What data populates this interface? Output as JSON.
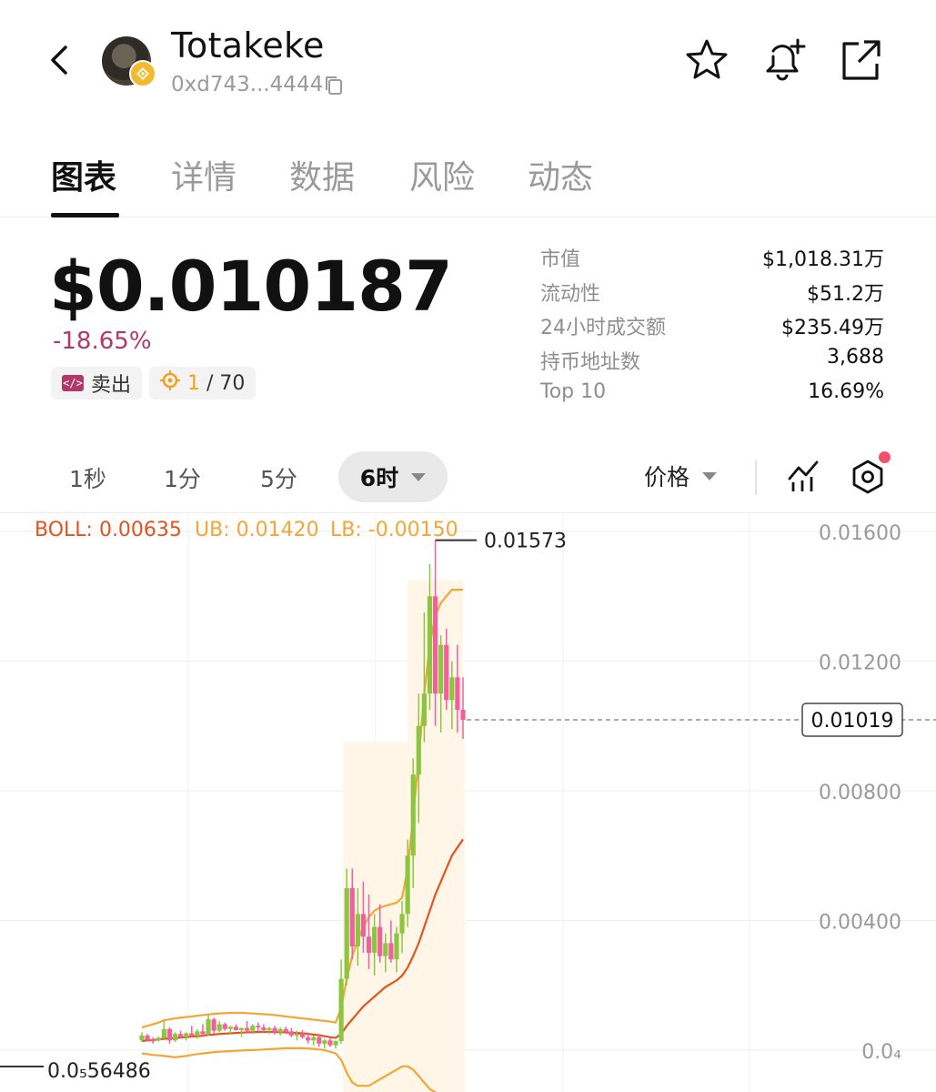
{
  "header": {
    "back_icon": "chevron-left-icon",
    "token_name": "Totakeke",
    "address": "0xd743...4444",
    "icons": [
      "star-icon",
      "bell-plus-icon",
      "external-link-icon"
    ]
  },
  "tabs": [
    {
      "label": "图表",
      "active": true
    },
    {
      "label": "详情",
      "active": false
    },
    {
      "label": "数据",
      "active": false
    },
    {
      "label": "风险",
      "active": false
    },
    {
      "label": "动态",
      "active": false
    }
  ],
  "price": {
    "value": "$0.010187",
    "change": "-18.65%",
    "change_color": "#b0386a",
    "sell_label": "卖出",
    "rank_highlight": "1",
    "rank_rest": " / 70"
  },
  "stats": [
    {
      "label": "市值",
      "value": "$1,018.31万"
    },
    {
      "label": "流动性",
      "value": "$51.2万"
    },
    {
      "label": "24小时成交额",
      "value": "$235.49万"
    },
    {
      "label": "持币地址数",
      "value": "3,688"
    },
    {
      "label": "Top 10",
      "value": "16.69%"
    }
  ],
  "timeframes": {
    "options": [
      "1秒",
      "1分",
      "5分"
    ],
    "selected": "6时",
    "price_mode": "价格"
  },
  "indicator": {
    "boll": "BOLL: 0.00635",
    "ub": "UB: 0.01420",
    "lb": "LB: -0.00150",
    "boll_color": "#e0541e",
    "band_color": "#f3a536"
  },
  "chart_data": {
    "type": "candlestick",
    "y_ticks": [
      "0.01600",
      "0.01200",
      "0.00800",
      "0.00400",
      "0.0₄"
    ],
    "y_tick_values": [
      0.016,
      0.012,
      0.008,
      0.004,
      0.0
    ],
    "current_price_label": "0.01019",
    "current_price": 0.01019,
    "high_label": "0.01573",
    "high": 0.01573,
    "low_label": "0.0₅56486",
    "up_color": "#8cc63f",
    "down_color": "#f0609e",
    "candles": [
      [
        0.0003,
        0.00055,
        0.00025,
        0.00045
      ],
      [
        0.00045,
        0.0005,
        0.00028,
        0.00032
      ],
      [
        0.00032,
        0.0004,
        0.0002,
        0.0003
      ],
      [
        0.0003,
        0.00042,
        0.00026,
        0.00038
      ],
      [
        0.00038,
        0.0009,
        0.0003,
        0.00065
      ],
      [
        0.00065,
        0.0007,
        0.0002,
        0.0003
      ],
      [
        0.0003,
        0.00055,
        0.00025,
        0.0005
      ],
      [
        0.0005,
        0.0006,
        0.00035,
        0.0004
      ],
      [
        0.0004,
        0.00055,
        0.0003,
        0.00052
      ],
      [
        0.00052,
        0.00075,
        0.0004,
        0.00045
      ],
      [
        0.00045,
        0.00065,
        0.00035,
        0.00058
      ],
      [
        0.00058,
        0.0008,
        0.0004,
        0.0005
      ],
      [
        0.0005,
        0.0011,
        0.00045,
        0.00095
      ],
      [
        0.00095,
        0.001,
        0.0005,
        0.0006
      ],
      [
        0.0006,
        0.0009,
        0.00055,
        0.0008
      ],
      [
        0.0008,
        0.00085,
        0.0006,
        0.00065
      ],
      [
        0.00065,
        0.00075,
        0.0005,
        0.00072
      ],
      [
        0.00072,
        0.0008,
        0.0006,
        0.00062
      ],
      [
        0.00062,
        0.0007,
        0.0004,
        0.00068
      ],
      [
        0.00068,
        0.0009,
        0.00055,
        0.0006
      ],
      [
        0.0006,
        0.0008,
        0.0005,
        0.00075
      ],
      [
        0.00075,
        0.00085,
        0.0006,
        0.0007
      ],
      [
        0.0007,
        0.0008,
        0.00055,
        0.00062
      ],
      [
        0.00062,
        0.00072,
        0.0005,
        0.00068
      ],
      [
        0.00068,
        0.00075,
        0.00048,
        0.00055
      ],
      [
        0.00055,
        0.0007,
        0.00045,
        0.00065
      ],
      [
        0.00065,
        0.00072,
        0.0005,
        0.00058
      ],
      [
        0.00058,
        0.00068,
        0.0004,
        0.00045
      ],
      [
        0.00045,
        0.0006,
        0.0003,
        0.0005
      ],
      [
        0.0005,
        0.00062,
        0.00035,
        0.0004
      ],
      [
        0.0004,
        0.00055,
        0.0002,
        0.0003
      ],
      [
        0.0003,
        0.00045,
        0.00015,
        0.0004
      ],
      [
        0.0004,
        0.0005,
        0.0001,
        0.0002
      ],
      [
        0.0002,
        0.00035,
        5e-05,
        0.0003
      ],
      [
        0.0003,
        0.0004,
        0.0001,
        0.00015
      ],
      [
        0.00015,
        0.0003,
        5e-05,
        0.00028
      ],
      [
        0.00028,
        0.0028,
        0.0002,
        0.0022
      ],
      [
        0.0022,
        0.0056,
        0.002,
        0.005
      ],
      [
        0.005,
        0.0056,
        0.0028,
        0.0032
      ],
      [
        0.0032,
        0.005,
        0.0026,
        0.0042
      ],
      [
        0.0042,
        0.0052,
        0.003,
        0.0035
      ],
      [
        0.0035,
        0.0048,
        0.0025,
        0.003
      ],
      [
        0.003,
        0.0042,
        0.0023,
        0.0038
      ],
      [
        0.0038,
        0.0045,
        0.0027,
        0.0029
      ],
      [
        0.0029,
        0.0036,
        0.0024,
        0.0033
      ],
      [
        0.0033,
        0.004,
        0.0027,
        0.0028
      ],
      [
        0.0028,
        0.0038,
        0.0024,
        0.0036
      ],
      [
        0.0036,
        0.0046,
        0.003,
        0.0042
      ],
      [
        0.0042,
        0.0065,
        0.0038,
        0.006
      ],
      [
        0.006,
        0.009,
        0.005,
        0.0085
      ],
      [
        0.0085,
        0.011,
        0.007,
        0.01
      ],
      [
        0.01,
        0.0135,
        0.0095,
        0.011
      ],
      [
        0.011,
        0.015,
        0.0105,
        0.014
      ],
      [
        0.014,
        0.01573,
        0.01,
        0.011
      ],
      [
        0.011,
        0.0128,
        0.0098,
        0.0125
      ],
      [
        0.0125,
        0.013,
        0.0105,
        0.0108
      ],
      [
        0.0108,
        0.012,
        0.0099,
        0.0115
      ],
      [
        0.0115,
        0.0125,
        0.0098,
        0.0105
      ],
      [
        0.0105,
        0.0115,
        0.0096,
        0.01019
      ]
    ],
    "boll_mid": [
      0.00028,
      0.0003,
      0.00031,
      0.00033,
      0.00035,
      0.00036,
      0.00037,
      0.00039,
      0.0004,
      0.00042,
      0.00043,
      0.00045,
      0.00047,
      0.00048,
      0.0005,
      0.00051,
      0.00052,
      0.00053,
      0.00054,
      0.00055,
      0.00055,
      0.00056,
      0.00056,
      0.00056,
      0.00056,
      0.00055,
      0.00055,
      0.00054,
      0.00053,
      0.00052,
      0.0005,
      0.00048,
      0.00046,
      0.00043,
      0.0004,
      0.00038,
      0.0005,
      0.00075,
      0.00095,
      0.00115,
      0.00135,
      0.0015,
      0.00165,
      0.0018,
      0.00195,
      0.00205,
      0.00215,
      0.0023,
      0.00255,
      0.0029,
      0.0033,
      0.0038,
      0.0043,
      0.0048,
      0.0052,
      0.0056,
      0.006,
      0.00625,
      0.0065
    ],
    "boll_ub": [
      0.0007,
      0.00075,
      0.0008,
      0.00085,
      0.00092,
      0.00095,
      0.00098,
      0.001,
      0.00102,
      0.00104,
      0.00106,
      0.00108,
      0.0011,
      0.00112,
      0.00113,
      0.00114,
      0.00115,
      0.00115,
      0.00115,
      0.00114,
      0.00113,
      0.00112,
      0.00111,
      0.0011,
      0.00108,
      0.00106,
      0.00104,
      0.00102,
      0.001,
      0.00098,
      0.00096,
      0.00094,
      0.00092,
      0.0009,
      0.00088,
      0.00085,
      0.0013,
      0.0022,
      0.0029,
      0.0034,
      0.0038,
      0.0041,
      0.0043,
      0.0044,
      0.00445,
      0.0045,
      0.00455,
      0.0047,
      0.0056,
      0.0072,
      0.009,
      0.011,
      0.0125,
      0.0134,
      0.0138,
      0.014,
      0.0142,
      0.0142,
      0.0142
    ],
    "boll_lb": [
      -0.0001,
      -0.00012,
      -0.00015,
      -0.00016,
      -0.00018,
      -0.0002,
      -0.00022,
      -0.0002,
      -0.00018,
      -0.00015,
      -0.00012,
      -0.0001,
      -8e-05,
      -6e-05,
      -5e-05,
      -4e-05,
      -3e-05,
      -2e-05,
      -1e-05,
      0.0,
      0.0,
      1e-05,
      2e-05,
      3e-05,
      4e-05,
      5e-05,
      6e-05,
      6e-05,
      6e-05,
      6e-05,
      5e-05,
      4e-05,
      2e-05,
      0.0,
      -5e-05,
      -0.0001,
      -0.0003,
      -0.0007,
      -0.001,
      -0.0011,
      -0.0011,
      -0.0011,
      -0.001,
      -0.0009,
      -0.0008,
      -0.0007,
      -0.0006,
      -0.0005,
      -0.0005,
      -0.0006,
      -0.0008,
      -0.001,
      -0.0012,
      -0.0013,
      -0.0014,
      -0.00145,
      -0.0015,
      -0.0015,
      -0.0015
    ]
  }
}
